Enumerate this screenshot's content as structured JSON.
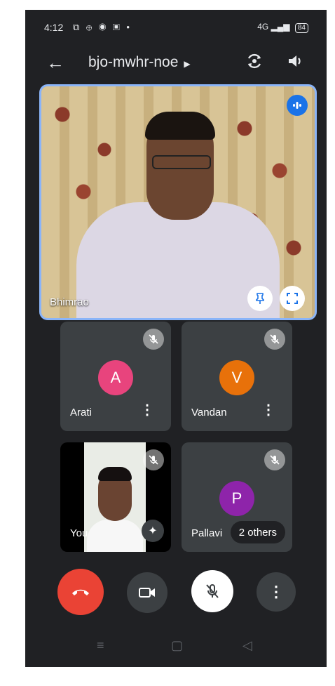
{
  "status_bar": {
    "time": "4:12",
    "notif_icons": "⧉ ⊕ ◉ ▣ •",
    "net": "4G",
    "battery": "84"
  },
  "meeting": {
    "code": "bjo-mwhr-noe"
  },
  "main_tile": {
    "name": "Bhimrao"
  },
  "participants": [
    {
      "name": "Arati",
      "initial": "A",
      "color": "#e8447d"
    },
    {
      "name": "Vandan",
      "initial": "V",
      "color": "#e8710a"
    },
    {
      "name": "You"
    },
    {
      "name": "Pallavi",
      "initial": "P",
      "color": "#8e24aa",
      "others": "2 others"
    }
  ],
  "colors": {
    "end_call": "#ea4335",
    "active_border": "#8ab4f8",
    "background": "#202124"
  }
}
